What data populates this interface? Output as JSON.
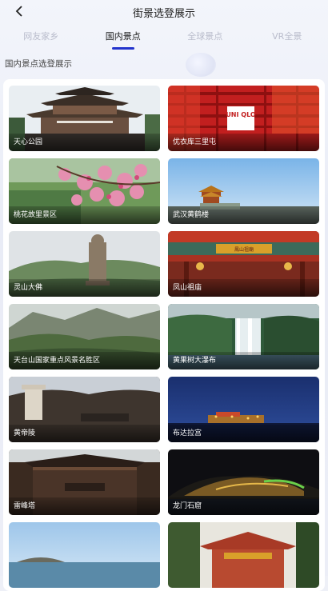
{
  "header": {
    "title": "街景选登展示",
    "back_icon": "chevron-left-icon"
  },
  "tabs": [
    {
      "label": "网友家乡",
      "active": false
    },
    {
      "label": "国内景点",
      "active": true
    },
    {
      "label": "全球景点",
      "active": false
    },
    {
      "label": "VR全景",
      "active": false
    }
  ],
  "section": {
    "title": "国内景点选登展示"
  },
  "cards": [
    {
      "label": "天心公园"
    },
    {
      "label": "优衣库三里屯",
      "sign_text": "UNI QLO"
    },
    {
      "label": "桃花故里景区"
    },
    {
      "label": "武汉黄鹤楼"
    },
    {
      "label": "灵山大佛"
    },
    {
      "label": "凤山祖庙",
      "sign_text": "鳳山祖廟"
    },
    {
      "label": "天台山国家重点风景名胜区"
    },
    {
      "label": "黄果树大瀑布"
    },
    {
      "label": "黄帝陵"
    },
    {
      "label": "布达拉宫"
    },
    {
      "label": "雷峰塔"
    },
    {
      "label": "龙门石窟"
    },
    {
      "label": ""
    },
    {
      "label": ""
    }
  ],
  "colors": {
    "accent": "#2233cc"
  }
}
